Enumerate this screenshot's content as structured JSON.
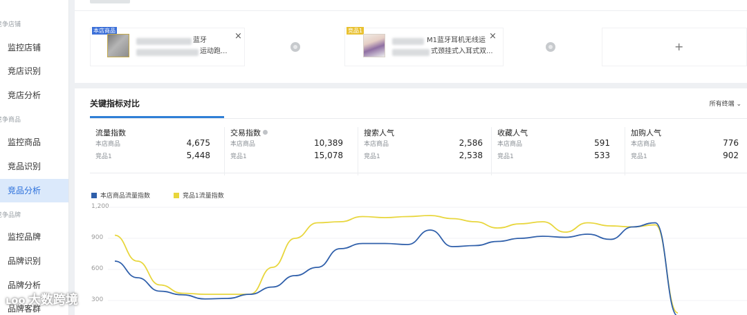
{
  "sidebar": {
    "sections": [
      {
        "title": "竞争店铺",
        "items": [
          "监控店铺",
          "竞店识别",
          "竞店分析"
        ]
      },
      {
        "title": "竞争商品",
        "items": [
          "监控商品",
          "竞品识别",
          "竞品分析"
        ]
      },
      {
        "title": "竞争品牌",
        "items": [
          "监控品牌",
          "品牌识别",
          "品牌分析",
          "品牌客群"
        ]
      }
    ],
    "active": "竞品分析"
  },
  "compare": {
    "item1": {
      "badge": "本店商品",
      "title_line1": "蓝牙",
      "title_line2": "运动跑..."
    },
    "item2": {
      "badge": "竞品1",
      "title_line1": "M1蓝牙耳机无线运",
      "title_line2": "式颈挂式入耳式双..."
    },
    "close_glyph": "×",
    "add_glyph": "+"
  },
  "key_metrics": {
    "title": "关键指标对比",
    "filter": "所有终端",
    "metrics": [
      {
        "label": "流量指数",
        "sub1": "本店商品",
        "v1": "4,675",
        "sub2": "竞品1",
        "v2": "5,448"
      },
      {
        "label": "交易指数",
        "sub1": "本店商品",
        "v1": "10,389",
        "sub2": "竞品1",
        "v2": "15,078"
      },
      {
        "label": "搜索人气",
        "sub1": "本店商品",
        "v1": "2,586",
        "sub2": "竞品1",
        "v2": "2,538"
      },
      {
        "label": "收藏人气",
        "sub1": "本店商品",
        "v1": "591",
        "sub2": "竞品1",
        "v2": "533"
      },
      {
        "label": "加购人气",
        "sub1": "本店商品",
        "v1": "776",
        "sub2": "竞品1",
        "v2": "902"
      }
    ]
  },
  "colors": {
    "blue_series": "#2f5faa",
    "yellow_series": "#e8d63c",
    "accent": "#2f7fd6"
  },
  "chart_data": {
    "type": "line",
    "ylim": [
      300,
      1200
    ],
    "yticks": [
      "1,200",
      "900",
      "600",
      "300"
    ],
    "ytick_values": [
      1200,
      900,
      600,
      300
    ],
    "series": [
      {
        "name": "本店商品流量指数",
        "values": [
          680,
          520,
          390,
          355,
          315,
          320,
          360,
          430,
          540,
          620,
          800,
          850,
          850,
          840,
          980,
          820,
          830,
          870,
          900,
          920,
          910,
          940,
          890,
          1010,
          1050,
          150
        ]
      },
      {
        "name": "竞品1流量指数",
        "values": [
          930,
          680,
          450,
          370,
          360,
          360,
          360,
          620,
          900,
          1050,
          1060,
          1110,
          1100,
          1110,
          1120,
          1090,
          1060,
          1000,
          1040,
          1060,
          960,
          1050,
          1020,
          1010,
          1030,
          180
        ]
      }
    ]
  },
  "watermark": {
    "logo": "ʟoo",
    "text": "大数跨境"
  }
}
